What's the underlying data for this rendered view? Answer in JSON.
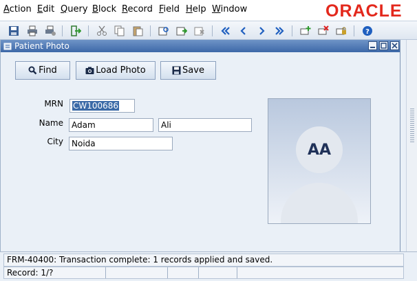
{
  "menu": {
    "items": [
      {
        "label": "Action",
        "mnemonic": "A"
      },
      {
        "label": "Edit",
        "mnemonic": "E"
      },
      {
        "label": "Query",
        "mnemonic": "Q"
      },
      {
        "label": "Block",
        "mnemonic": "B"
      },
      {
        "label": "Record",
        "mnemonic": "R"
      },
      {
        "label": "Field",
        "mnemonic": "F"
      },
      {
        "label": "Help",
        "mnemonic": "H"
      },
      {
        "label": "Window",
        "mnemonic": "W"
      }
    ],
    "brand": "ORACLE",
    "brand_color": "#e3281c"
  },
  "toolbar": {
    "icons": [
      "save-icon",
      "print-icon",
      "print-setup-icon",
      "exit-icon",
      "cut-icon",
      "copy-icon",
      "paste-icon",
      "enter-query-icon",
      "execute-query-icon",
      "cancel-query-icon",
      "first-record-icon",
      "previous-record-icon",
      "next-record-icon",
      "last-record-icon",
      "insert-record-icon",
      "delete-record-icon",
      "lock-record-icon",
      "help-icon"
    ]
  },
  "window": {
    "title": "Patient Photo",
    "buttons": {
      "find": "Find",
      "load_photo": "Load Photo",
      "save": "Save"
    },
    "form": {
      "mrn_label": "MRN",
      "mrn_value": "CW100686",
      "name_label": "Name",
      "first_name": "Adam",
      "last_name": "Ali",
      "city_label": "City",
      "city_value": "Noida"
    },
    "photo": {
      "initials": "AA"
    }
  },
  "status": {
    "message": "FRM-40400: Transaction complete: 1 records applied and saved.",
    "record": "Record: 1/?"
  },
  "colors": {
    "accent": "#3d68a8",
    "toolbar_icon_blue": "#1f5fbf"
  }
}
